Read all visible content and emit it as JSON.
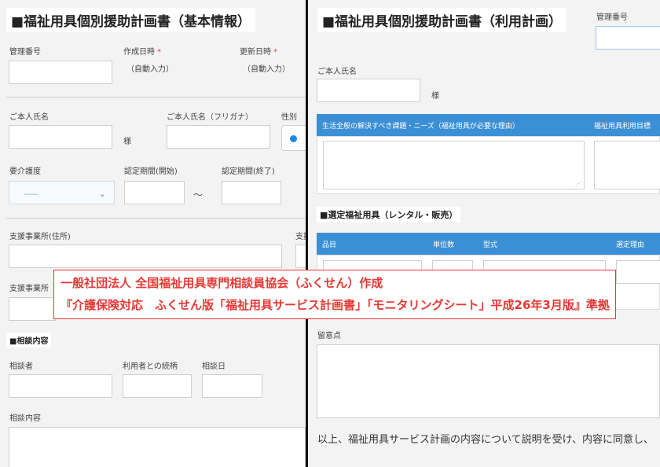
{
  "left": {
    "title": "■福祉用具個別援助計画書（基本情報）",
    "mgmt_no_label": "管理番号",
    "created_label": "作成日時",
    "created_value": "（自動入力）",
    "updated_label": "更新日時",
    "updated_value": "（自動入力）",
    "required_mark": "*",
    "name_label": "ご本人氏名",
    "honorific": "様",
    "kana_label": "ご本人氏名（フリガナ）",
    "gender_label": "性別",
    "care_level_label": "要介護度",
    "care_level_value": "-----",
    "period_start_label": "認定期間(開始)",
    "period_end_label": "認定期間(終了)",
    "tilde": "～",
    "office_addr_label": "支援事業所(住所)",
    "office_addr_label_cut": "支援",
    "office_name_label_cut": "支援事業所",
    "consult_section": "■相談内容",
    "consultant_label": "相談者",
    "relation_label": "利用者との続柄",
    "consult_date_label": "相談日",
    "consult_content_label": "相談内容"
  },
  "right": {
    "title": "■福祉用具個別援助計画書（利用計画）",
    "mgmt_no_label": "管理番号",
    "name_label": "ご本人氏名",
    "honorific": "様",
    "issues_header": "生活全般の解決すべき課題・ニーズ（福祉用具が必要な理由）",
    "goal_header": "福祉用具利用目標",
    "selected_section": "■選定福祉用具（レンタル・販売）",
    "col_item": "品目",
    "col_units": "単位数",
    "col_model": "型式",
    "col_reason": "選定理由",
    "remarks_label": "留意点",
    "consent_text": "以上、福祉用具サービス計画の内容について説明を受け、内容に同意し、"
  },
  "banner": {
    "line1": "一般社団法人 全国福祉用具専門相談員協会（ふくせん）作成",
    "line2": "『介護保険対応　ふくせん版「福祉用具サービス計画書」「モニタリングシート」平成26年3月版』準拠"
  },
  "colors": {
    "accent": "#3b8fd5",
    "banner_red": "#e53935",
    "radio_blue": "#1e88e5"
  }
}
